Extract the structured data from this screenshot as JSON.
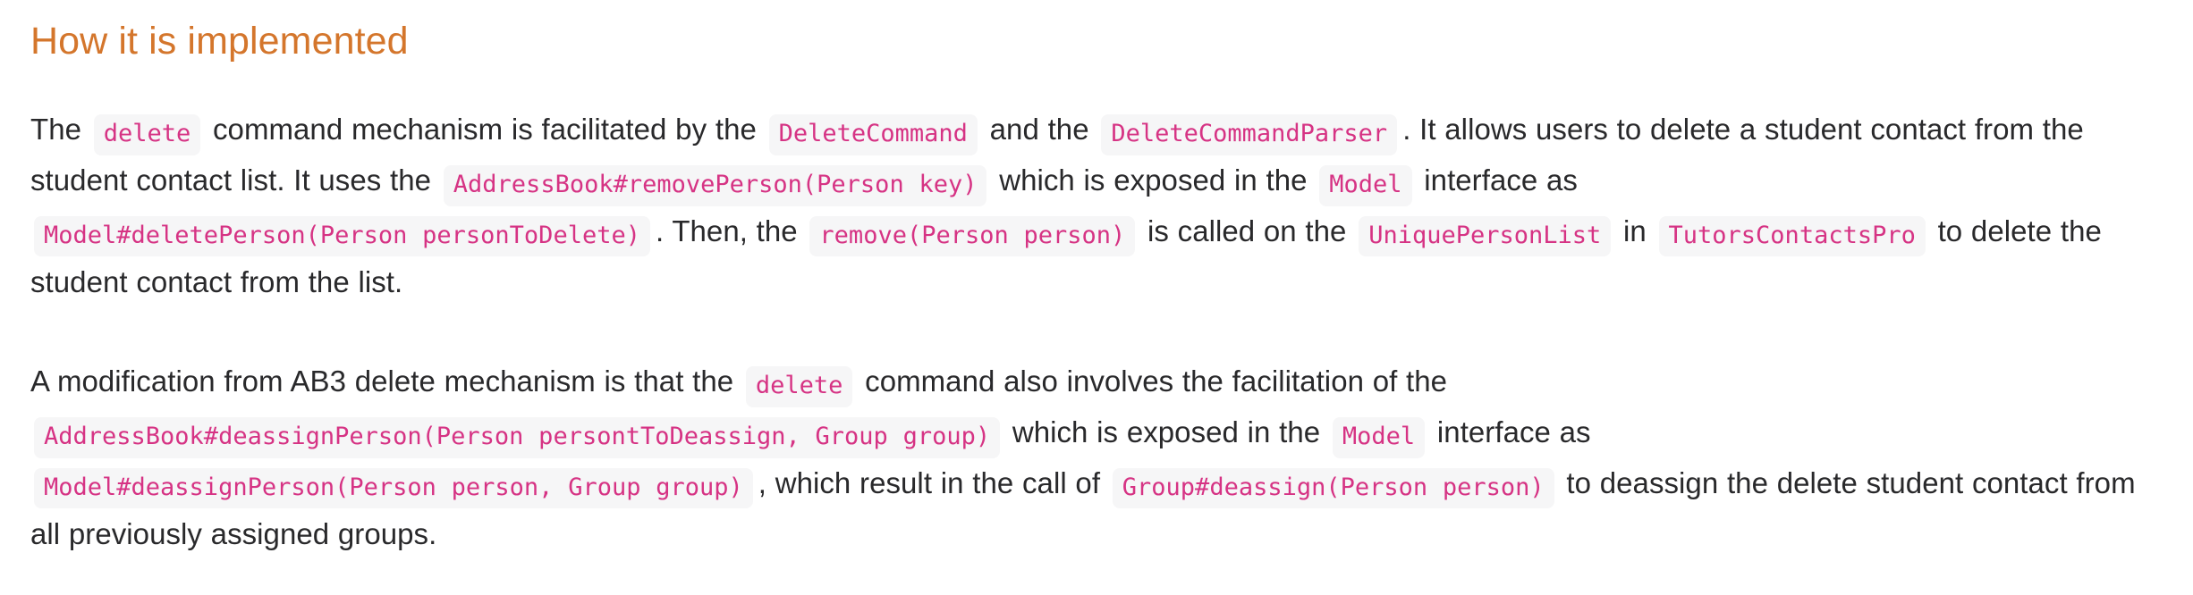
{
  "page": {
    "background_color": "#ffffff",
    "heading_color": "#d4762c",
    "body_text_color": "#29292b",
    "code_text_color": "#d63384",
    "code_background_color": "#f6f6f7"
  },
  "heading": {
    "text": "How it is implemented"
  },
  "paragraphs": [
    {
      "id": "delete-mechanism-overview",
      "segments": [
        {
          "type": "text",
          "value": "The "
        },
        {
          "type": "code",
          "value": "delete"
        },
        {
          "type": "text",
          "value": " command mechanism is facilitated by the "
        },
        {
          "type": "code",
          "value": "DeleteCommand"
        },
        {
          "type": "text",
          "value": " and the "
        },
        {
          "type": "code",
          "value": "DeleteCommandParser"
        },
        {
          "type": "text",
          "value": ". It allows users to delete a student contact from the student contact list. It uses the "
        },
        {
          "type": "code",
          "value": "AddressBook#removePerson(Person key)"
        },
        {
          "type": "text",
          "value": " which is exposed in the "
        },
        {
          "type": "code",
          "value": "Model"
        },
        {
          "type": "text",
          "value": " interface as "
        },
        {
          "type": "code",
          "value": "Model#deletePerson(Person personToDelete)"
        },
        {
          "type": "text",
          "value": ". Then, the "
        },
        {
          "type": "code",
          "value": "remove(Person person)"
        },
        {
          "type": "text",
          "value": " is called on the "
        },
        {
          "type": "code",
          "value": "UniquePersonList"
        },
        {
          "type": "text",
          "value": " in "
        },
        {
          "type": "code",
          "value": "TutorsContactsPro"
        },
        {
          "type": "text",
          "value": " to delete the student contact from the list."
        }
      ]
    },
    {
      "id": "ab3-modification",
      "segments": [
        {
          "type": "text",
          "value": "A modification from AB3 delete mechanism is that the "
        },
        {
          "type": "code",
          "value": "delete"
        },
        {
          "type": "text",
          "value": " command also involves the facilitation of the "
        },
        {
          "type": "code",
          "value": "AddressBook#deassignPerson(Person persontToDeassign, Group group)"
        },
        {
          "type": "text",
          "value": " which is exposed in the "
        },
        {
          "type": "code",
          "value": "Model"
        },
        {
          "type": "text",
          "value": " interface as "
        },
        {
          "type": "code",
          "value": "Model#deassignPerson(Person person, Group group)"
        },
        {
          "type": "text",
          "value": ", which result in the call of "
        },
        {
          "type": "code",
          "value": "Group#deassign(Person person)"
        },
        {
          "type": "text",
          "value": " to deassign the delete student contact from all previously assigned groups."
        }
      ]
    }
  ]
}
